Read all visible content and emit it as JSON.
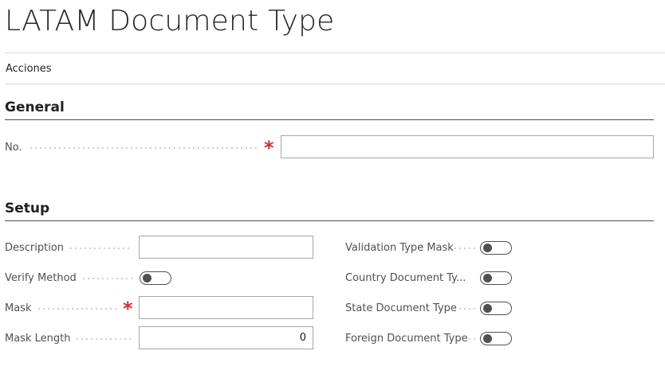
{
  "page": {
    "title": "LATAM Document Type"
  },
  "actions": {
    "label": "Acciones"
  },
  "general": {
    "title": "General",
    "no": {
      "label": "No.",
      "value": "",
      "required": true
    }
  },
  "setup": {
    "title": "Setup",
    "description": {
      "label": "Description",
      "value": ""
    },
    "verify_method": {
      "label": "Verify Method",
      "on": false
    },
    "mask": {
      "label": "Mask",
      "value": "",
      "required": true
    },
    "mask_length": {
      "label": "Mask Length",
      "value": "0"
    },
    "validation_type_mask": {
      "label": "Validation Type Mask",
      "on": false
    },
    "country_document_type": {
      "label": "Country Document Ty...",
      "on": false
    },
    "state_document_type": {
      "label": "State Document Type",
      "on": false
    },
    "foreign_document_type": {
      "label": "Foreign Document Type",
      "on": false
    }
  },
  "colors": {
    "required": "#d32f2f",
    "section_rule": "#505050",
    "toggle": "#505050"
  }
}
